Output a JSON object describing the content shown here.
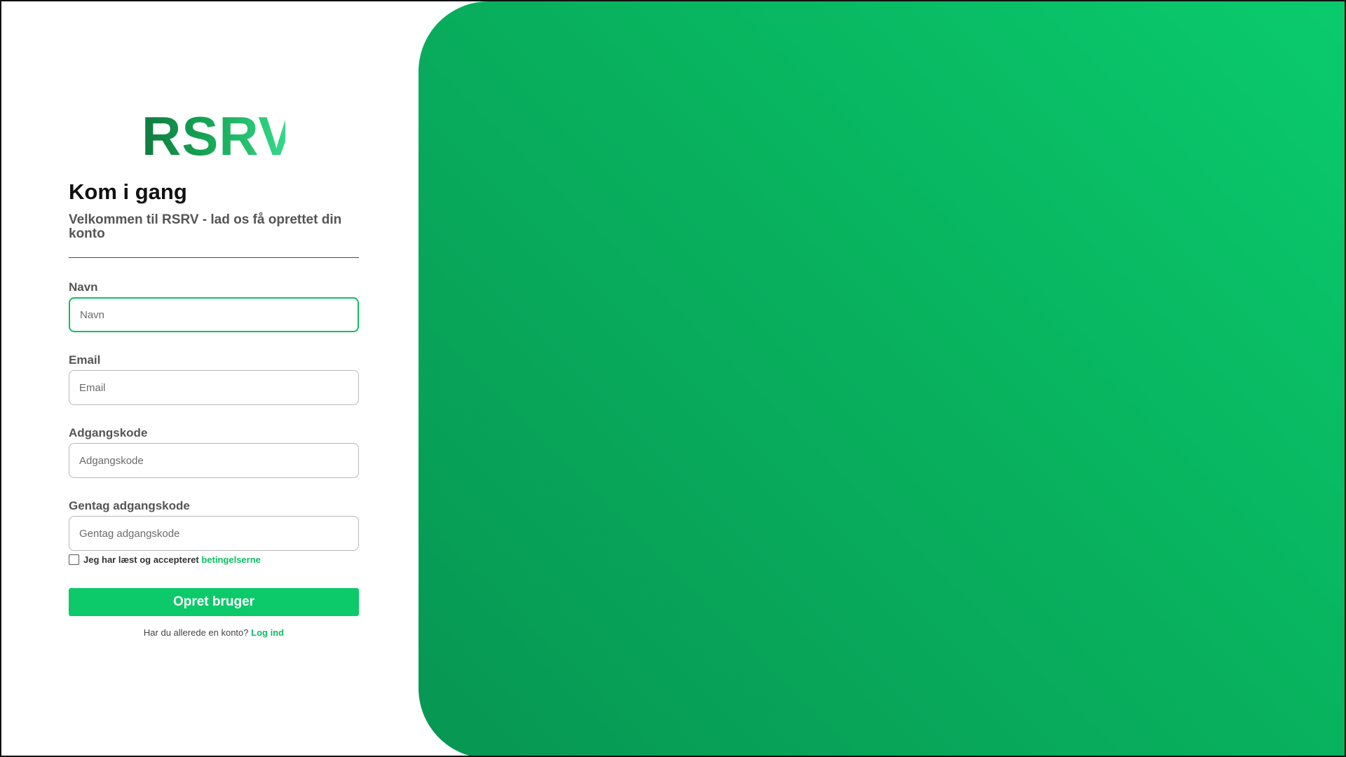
{
  "brand": {
    "logo_text": "RSRV"
  },
  "header": {
    "title": "Kom i gang",
    "subtitle": "Velkommen til RSRV - lad os få oprettet din konto"
  },
  "form": {
    "fields": [
      {
        "label": "Navn",
        "placeholder": "Navn",
        "value": "",
        "focused": true
      },
      {
        "label": "Email",
        "placeholder": "Email",
        "value": ""
      },
      {
        "label": "Adgangskode",
        "placeholder": "Adgangskode",
        "value": ""
      },
      {
        "label": "Gentag adgangskode",
        "placeholder": "Gentag adgangskode",
        "value": ""
      }
    ],
    "terms": {
      "checked": false,
      "text": "Jeg har læst og accepteret",
      "link_text": "betingelserne"
    },
    "submit_label": "Opret bruger",
    "login_prompt": "Har du allerede en konto?",
    "login_link": "Log ind"
  },
  "colors": {
    "accent": "#0cc96a",
    "hero_gradient_light": "#0acb6e",
    "hero_gradient_dark": "#079653",
    "logo_dark": "#117a3e",
    "logo_light": "#35d98a"
  }
}
